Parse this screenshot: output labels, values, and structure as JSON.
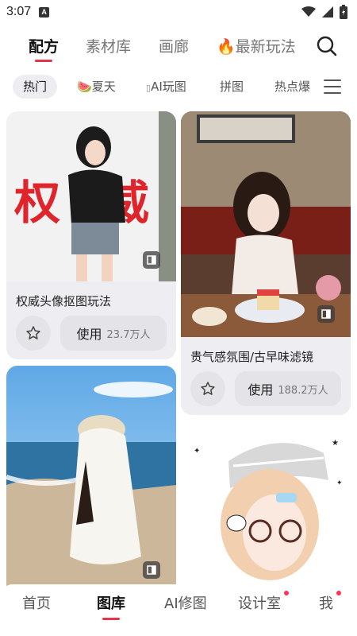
{
  "status_bar": {
    "time": "3:07",
    "notif_letter": "A"
  },
  "top_tabs": [
    {
      "label": "配方",
      "active": true
    },
    {
      "label": "素材库",
      "active": false
    },
    {
      "label": "画廊",
      "active": false
    },
    {
      "label": "最新玩法",
      "prefix_icon": "fire-icon",
      "active": false
    }
  ],
  "chips": [
    {
      "label": "热门",
      "active": true
    },
    {
      "label": "夏天",
      "prefix_icon": "watermelon-icon"
    },
    {
      "label": "AI玩图",
      "prefix_icon": "unknown-glyph"
    },
    {
      "label": "拼图"
    },
    {
      "label": "热点爆"
    }
  ],
  "cards": [
    {
      "title": "权威头像抠图玩法",
      "use_label": "使用",
      "use_count": "23.7万人",
      "image_text": "权 威"
    },
    {
      "title": "贵气感氛围/古早味滤镜",
      "use_label": "使用",
      "use_count": "188.2万人"
    },
    {
      "title": ""
    },
    {
      "title": ""
    }
  ],
  "bottom_nav": [
    {
      "label": "首页",
      "active": false
    },
    {
      "label": "图库",
      "active": true
    },
    {
      "label": "AI修图",
      "active": false
    },
    {
      "label": "设计室",
      "active": false,
      "dot": true
    },
    {
      "label": "我",
      "active": false,
      "dot": true
    }
  ],
  "colors": {
    "accent": "#e9334b",
    "card_bg": "#eeeef2",
    "button_bg": "#e3e3e8"
  }
}
